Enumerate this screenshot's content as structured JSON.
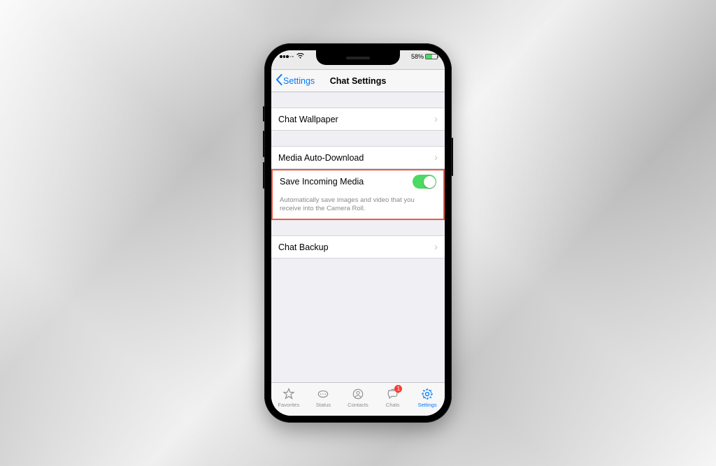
{
  "status": {
    "battery_pct": "58%"
  },
  "nav": {
    "back_label": "Settings",
    "title": "Chat Settings"
  },
  "rows": {
    "wallpaper": "Chat Wallpaper",
    "autodownload": "Media Auto-Download",
    "save_media": "Save Incoming Media",
    "save_media_desc": "Automatically save images and video that you receive into the Camera Roll.",
    "backup": "Chat Backup"
  },
  "tabs": {
    "favorites": "Favorites",
    "status": "Status",
    "contacts": "Contacts",
    "chats": "Chats",
    "chats_badge": "1",
    "settings": "Settings"
  },
  "toggle": {
    "save_media_on": true
  },
  "colors": {
    "accent": "#007aff",
    "toggle_on": "#4cd964",
    "highlight": "#ec5a47"
  }
}
